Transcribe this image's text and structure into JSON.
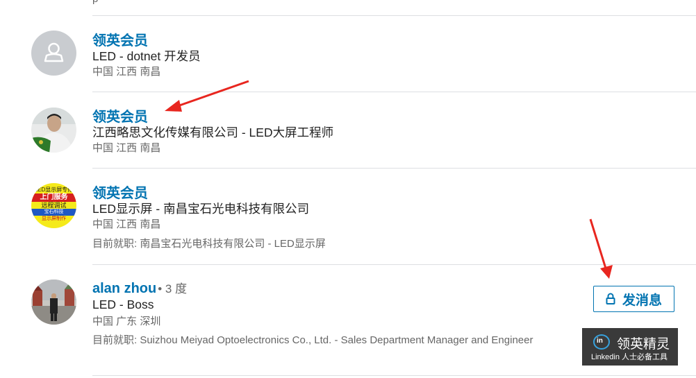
{
  "results": [
    {
      "name": "领英会员",
      "headline": "LED - dotnet 开发员",
      "location": "中国 江西 南昌"
    },
    {
      "name": "领英会员",
      "headline": "江西略思文化传媒有限公司 - LED大屏工程师",
      "location": "中国 江西 南昌"
    },
    {
      "name": "领英会员",
      "headline": "LED显示屏 - 南昌宝石光电科技有限公司",
      "location": "中国 江西 南昌",
      "current": "目前就职: 南昌宝石光电科技有限公司 - LED显示屏",
      "avatar_text": [
        "LED显示屏专修",
        "上门服务",
        "远程调试",
        "宝石科技",
        "显示屏制作"
      ]
    },
    {
      "name": "alan zhou",
      "degree": "• 3 度",
      "headline": "LED - Boss",
      "location": "中国 广东 深圳",
      "current": "目前就职: Suizhou Meiyad Optoelectronics Co., Ltd. - Sales Department Manager and Engineer",
      "message_button": "发消息"
    }
  ],
  "badge": {
    "title": "领英精灵",
    "subtitle": "Linkedin 人士必备工具"
  },
  "colors": {
    "link": "#0073b1",
    "annotation_arrow": "#e8261f",
    "badge_bg": "#3a3a3a"
  }
}
